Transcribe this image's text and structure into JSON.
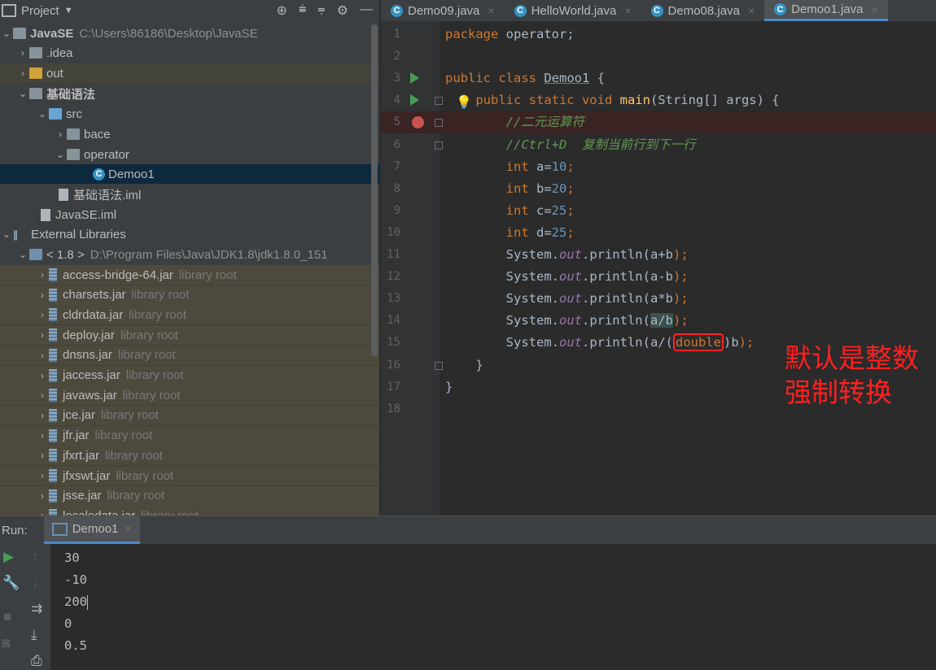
{
  "project_panel": {
    "title": "Project",
    "tree": [
      {
        "label": "JavaSE",
        "path": "C:\\Users\\86186\\Desktop\\JavaSE"
      },
      {
        "label": ".idea"
      },
      {
        "label": "out"
      },
      {
        "label": "基础语法"
      },
      {
        "label": "src"
      },
      {
        "label": "bace"
      },
      {
        "label": "operator"
      },
      {
        "label": "Demoo1"
      },
      {
        "label": "基础语法.iml"
      },
      {
        "label": "JavaSE.iml"
      },
      {
        "label": "External Libraries"
      },
      {
        "label": "< 1.8 >",
        "path": "D:\\Program Files\\Java\\JDK1.8\\jdk1.8.0_151"
      }
    ],
    "library_root_label": "library root",
    "jars": [
      "access-bridge-64.jar",
      "charsets.jar",
      "cldrdata.jar",
      "deploy.jar",
      "dnsns.jar",
      "jaccess.jar",
      "javaws.jar",
      "jce.jar",
      "jfr.jar",
      "jfxrt.jar",
      "jfxswt.jar",
      "jsse.jar",
      "localedata.jar"
    ]
  },
  "tabs": [
    {
      "label": "Demo09.java"
    },
    {
      "label": "HelloWorld.java"
    },
    {
      "label": "Demo08.java"
    },
    {
      "label": "Demoo1.java",
      "active": true
    }
  ],
  "editor": {
    "line_numbers": [
      "1",
      "2",
      "3",
      "4",
      "5",
      "6",
      "7",
      "8",
      "9",
      "10",
      "11",
      "12",
      "13",
      "14",
      "15",
      "16",
      "17",
      "18"
    ],
    "code": {
      "l1_kw": "package",
      "l1_rest": " operator;",
      "l3_kw": "public class ",
      "l3_cls": "Demoo1",
      "l3_rest": " {",
      "l4_kw": "public static void ",
      "l4_m": "main",
      "l4_rest": "(String[] args) {",
      "l5": "//二元运算符",
      "l6": "//Ctrl+D  复制当前行到下一行",
      "l7_kw": "int ",
      "l7_v": "a=",
      "l7_n": "10",
      "l7_e": ";",
      "l8_kw": "int ",
      "l8_v": "b=",
      "l8_n": "20",
      "l8_e": ";",
      "l9_kw": "int ",
      "l9_v": "c=",
      "l9_n": "25",
      "l9_e": ";",
      "l10_kw": "int ",
      "l10_v": "d=",
      "l10_n": "25",
      "l10_e": ";",
      "sys": "System.",
      "out": "out",
      "println": ".println(",
      "l11_arg": "a+b",
      "l12_arg": "a-b",
      "l13_arg": "a*b",
      "l14_arg": "a/b",
      "l15_pre": "a/(",
      "l15_cast": "double",
      "l15_post": ")b",
      "close_paren": ");",
      "l16": "}",
      "l17": "}"
    }
  },
  "annotation": {
    "line1": "默认是整数",
    "line2": "强制转换",
    "color": "#ff2020"
  },
  "run_panel": {
    "label": "Run:",
    "tab": "Demoo1",
    "output": [
      "30",
      "-10",
      "200",
      "0",
      "0.5"
    ]
  },
  "colors": {
    "keyword": "#cc7832",
    "comment": "#629755",
    "number": "#6897bb",
    "field": "#9876aa",
    "method": "#ffc66d",
    "selection": "#0d293e",
    "breakpoint": "#c75450",
    "run_marker": "#499c54"
  }
}
